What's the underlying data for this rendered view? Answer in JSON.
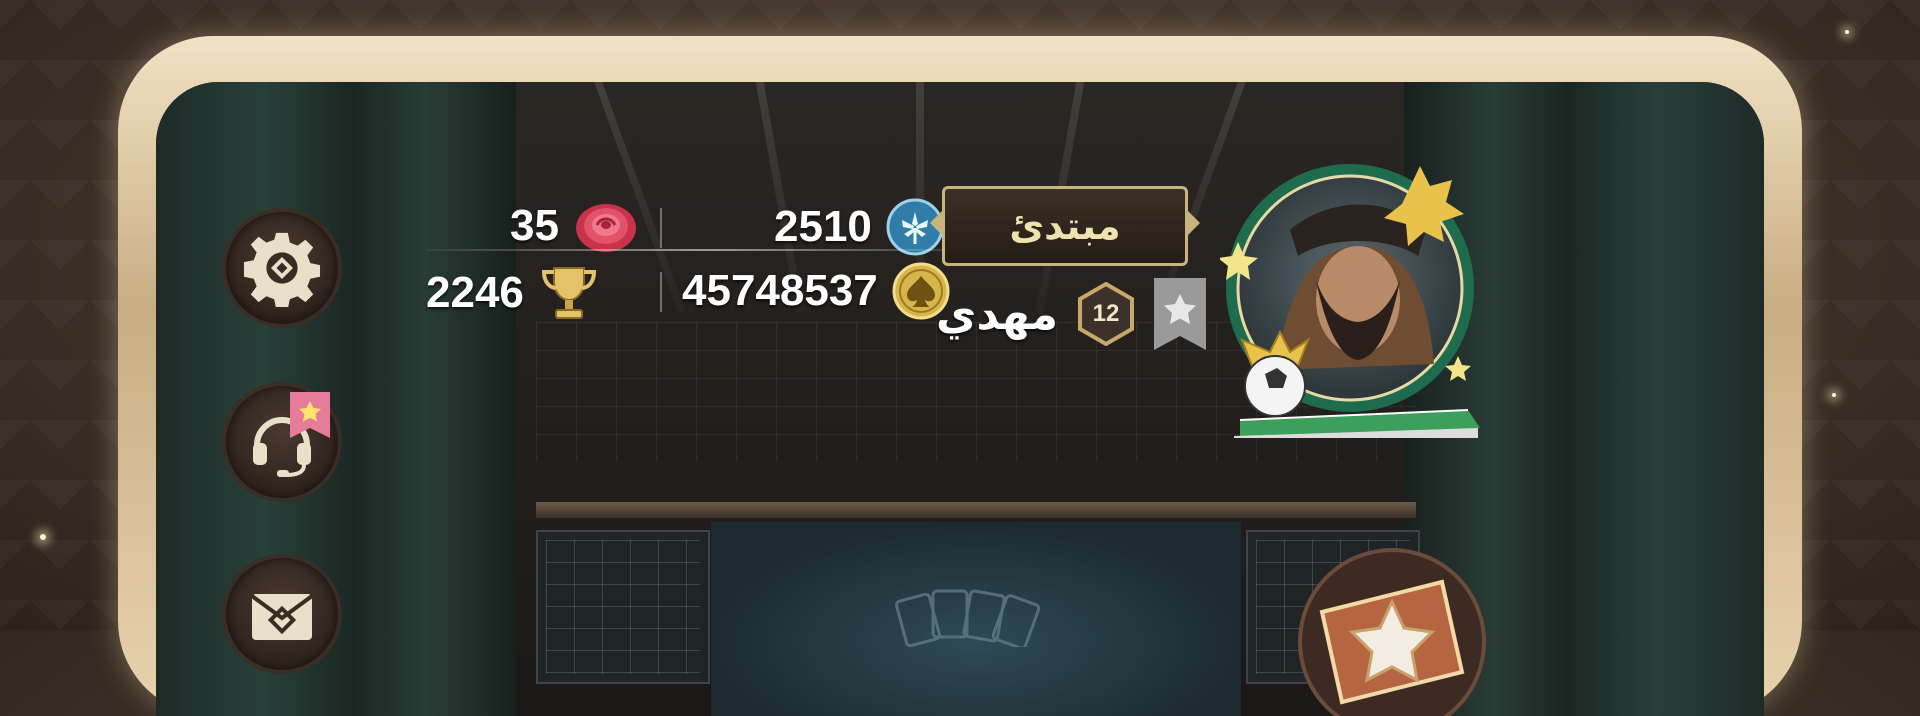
{
  "player": {
    "name": "مهدي",
    "level": "12",
    "rank": "مبتدئ"
  },
  "stats": {
    "roses": "35",
    "palm_points": "2510",
    "trophies": "2246",
    "coins": "45748537"
  },
  "sidebar": {
    "items": [
      {
        "name": "settings",
        "icon": "gear-icon"
      },
      {
        "name": "support",
        "icon": "headset-icon",
        "badge_icon": "star-icon"
      },
      {
        "name": "messages",
        "icon": "envelope-icon"
      }
    ]
  },
  "icons": {
    "rose": "rose-icon",
    "palm": "palm-emblem-icon",
    "trophy": "trophy-icon",
    "coin": "spade-coin-icon",
    "level_ribbon": "ribbon-star-icon"
  },
  "colors": {
    "gold": "#c8b47d",
    "frame": "#e4cfa8",
    "rose": "#d8415a",
    "palm_badge": "#2f7da8",
    "curtain": "#28403a"
  }
}
